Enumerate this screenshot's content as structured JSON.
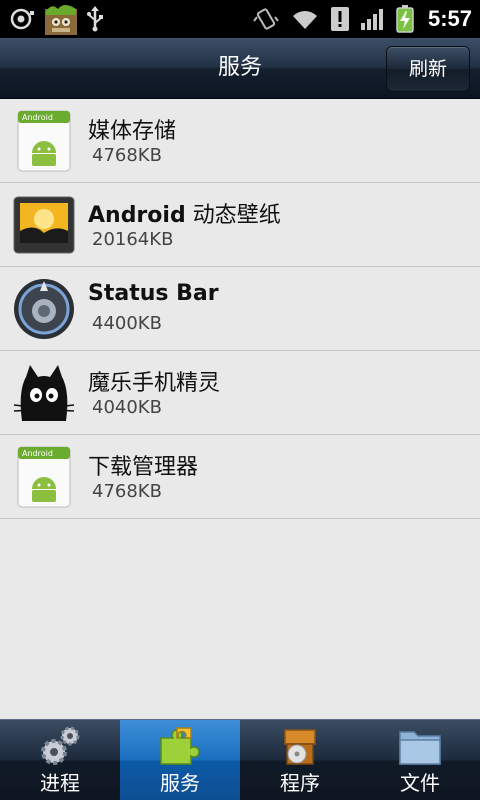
{
  "status_bar": {
    "time": "5:57",
    "icons": [
      "screenshot-icon",
      "app-notification-icon",
      "usb-icon",
      "vibrate-icon",
      "wifi-icon",
      "alert-icon",
      "signal-icon",
      "battery-charging-icon"
    ]
  },
  "header": {
    "title": "服务",
    "refresh_label": "刷新"
  },
  "services": [
    {
      "name": "媒体存储",
      "size": "4768KB",
      "icon": "android-package-icon"
    },
    {
      "name_en": "Android",
      "name_cn": " 动态壁纸",
      "size": "20164KB",
      "icon": "live-wallpaper-icon"
    },
    {
      "name": "Status Bar",
      "size": "4400KB",
      "icon": "status-bar-app-icon"
    },
    {
      "name": "魔乐手机精灵",
      "size": "4040KB",
      "icon": "cat-app-icon"
    },
    {
      "name": "下载管理器",
      "size": "4768KB",
      "icon": "android-package-icon"
    }
  ],
  "tabs": [
    {
      "label": "进程",
      "icon": "gears-icon",
      "active": false
    },
    {
      "label": "服务",
      "icon": "puzzle-icon",
      "active": true
    },
    {
      "label": "程序",
      "icon": "package-box-icon",
      "active": false
    },
    {
      "label": "文件",
      "icon": "folder-icon",
      "active": false
    }
  ],
  "colors": {
    "active_tab": "#1b6fbf",
    "title_bar": "#1c2838",
    "list_background": "#e8e8e8"
  }
}
